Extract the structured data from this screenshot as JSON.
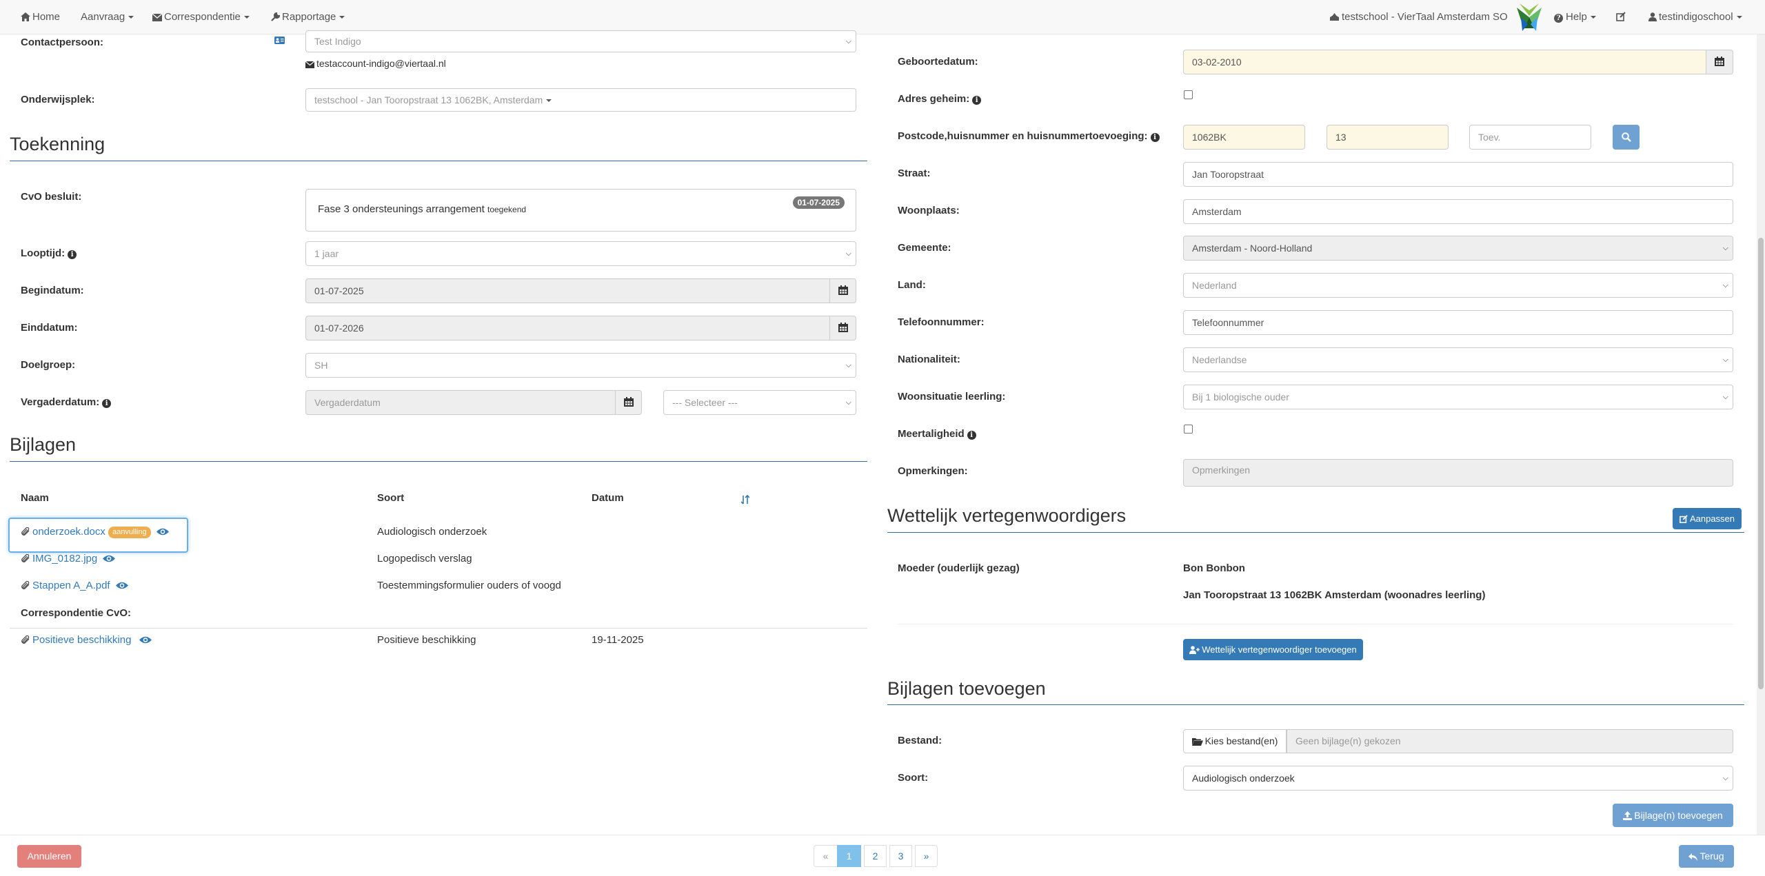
{
  "nav": {
    "home": "Home",
    "aanvraag": "Aanvraag",
    "correspondentie": "Correspondentie",
    "rapportage": "Rapportage",
    "school": "testschool - VierTaal Amsterdam SO",
    "help": "Help",
    "user": "testindigoschool"
  },
  "left": {
    "contactpersoon_label": "Contactpersoon:",
    "contactpersoon_value": "Test Indigo",
    "contact_email": "testaccount-indigo@viertaal.nl",
    "onderwijsplek_label": "Onderwijsplek:",
    "onderwijsplek_value": "testschool - Jan Tooropstraat 13 1062BK, Amsterdam",
    "toekenning_title": "Toekenning",
    "cvo_label": "CvO besluit:",
    "cvo_text": "Fase 3 ondersteunings arrangement",
    "cvo_status": "toegekend",
    "cvo_date": "01-07-2025",
    "looptijd_label": "Looptijd:",
    "looptijd_value": "1 jaar",
    "begindatum_label": "Begindatum:",
    "begindatum_value": "01-07-2025",
    "einddatum_label": "Einddatum:",
    "einddatum_value": "01-07-2026",
    "doelgroep_label": "Doelgroep:",
    "doelgroep_value": "SH",
    "vergaderdatum_label": "Vergaderdatum:",
    "vergaderdatum_placeholder": "Vergaderdatum",
    "vergader_select": "--- Selecteer ---",
    "bijlagen_title": "Bijlagen",
    "col_naam": "Naam",
    "col_soort": "Soort",
    "col_datum": "Datum",
    "files": [
      {
        "name": "onderzoek.docx",
        "badge": "aanvulling",
        "soort": "Audiologisch onderzoek",
        "datum": ""
      },
      {
        "name": "IMG_0182.jpg",
        "soort": "Logopedisch verslag",
        "datum": ""
      },
      {
        "name": "Stappen A_A.pdf",
        "soort": "Toestemmingsformulier ouders of voogd",
        "datum": ""
      }
    ],
    "correspondentie_label": "Correspondentie CvO:",
    "corr_file": {
      "name": "Positieve beschikking",
      "soort": "Positieve beschikking",
      "datum": "19-11-2025"
    }
  },
  "right": {
    "geboortedatum_label": "Geboortedatum:",
    "geboortedatum_value": "03-02-2010",
    "adres_geheim_label": "Adres geheim:",
    "postcode_label": "Postcode,huisnummer en huisnummertoevoeging:",
    "postcode_value": "1062BK",
    "huisnummer_value": "13",
    "toevoeging_placeholder": "Toev.",
    "straat_label": "Straat:",
    "straat_value": "Jan Tooropstraat",
    "woonplaats_label": "Woonplaats:",
    "woonplaats_value": "Amsterdam",
    "gemeente_label": "Gemeente:",
    "gemeente_value": "Amsterdam - Noord-Holland",
    "land_label": "Land:",
    "land_value": "Nederland",
    "telefoon_label": "Telefoonnummer:",
    "telefoon_placeholder": "Telefoonnummer",
    "nationaliteit_label": "Nationaliteit:",
    "nationaliteit_value": "Nederlandse",
    "woonsituatie_label": "Woonsituatie leerling:",
    "woonsituatie_value": "Bij 1 biologische ouder",
    "meertaligheid_label": "Meertaligheid",
    "opmerkingen_label": "Opmerkingen:",
    "opmerkingen_placeholder": "Opmerkingen",
    "wv_title": "Wettelijk vertegenwoordigers",
    "aanpassen": "Aanpassen",
    "wv_role": "Moeder (ouderlijk gezag)",
    "wv_name": "Bon Bonbon",
    "wv_address": "Jan Tooropstraat 13 1062BK Amsterdam (woonadres leerling)",
    "wv_add_button": "Wettelijk vertegenwoordiger toevoegen",
    "bt_title": "Bijlagen toevoegen",
    "bestand_label": "Bestand:",
    "kies_bestand": "Kies bestand(en)",
    "geen_bijlage": "Geen bijlage(n) gekozen",
    "soort_label": "Soort:",
    "soort_value": "Audiologisch onderzoek",
    "toevoegen_button": "Bijlage(n) toevoegen"
  },
  "footer": {
    "annuleren": "Annuleren",
    "pages": [
      "«",
      "1",
      "2",
      "3",
      "»"
    ],
    "active_page": "1",
    "terug": "Terug"
  },
  "colors": {
    "primary": "#337ab7",
    "danger_light": "#d9534f",
    "warning": "#f0ad4e",
    "readonly_bg": "#eeeeee",
    "highlight_bg": "#fcf8e3"
  }
}
